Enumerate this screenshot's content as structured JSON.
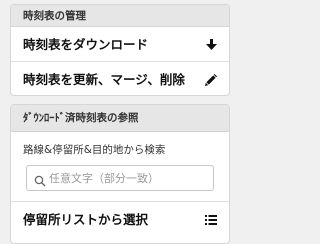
{
  "manage": {
    "header": "時刻表の管理",
    "download_label": "時刻表をダウンロード",
    "update_label": "時刻表を更新、マージ、削除"
  },
  "browse": {
    "header": "ﾀﾞｳﾝﾛｰﾄﾞ済時刻表の参照",
    "search_label": "路線&停留所&目的地から検索",
    "search_placeholder": "任意文字（部分一致）",
    "select_label": "停留所リストから選択"
  },
  "icons": {
    "download": "download-arrow-icon",
    "edit": "pencil-icon",
    "search": "search-icon",
    "list": "list-icon"
  },
  "colors": {
    "background": "#f0f0f0",
    "header_bg": "#e6e6e6",
    "card_bg": "#ffffff"
  }
}
